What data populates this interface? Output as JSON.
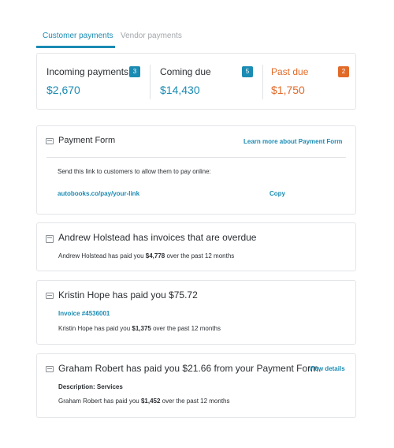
{
  "tabs": {
    "customer": "Customer payments",
    "vendor": "Vendor payments"
  },
  "summary": {
    "incoming": {
      "label": "Incoming payments",
      "count": "3",
      "amount": "$2,670"
    },
    "coming_due": {
      "label": "Coming due",
      "count": "5",
      "amount": "$14,430"
    },
    "past_due": {
      "label": "Past due",
      "count": "2",
      "amount": "$1,750"
    }
  },
  "payment_form": {
    "title": "Payment Form",
    "learn_more": "Learn more about Payment Form",
    "description": "Send this link to customers to allow them to pay online:",
    "link": "autobooks.co/pay/your-link",
    "copy": "Copy"
  },
  "activity": [
    {
      "title": "Andrew Holstead has invoices that are overdue",
      "summary_prefix": "Andrew Holstead has paid you",
      "summary_amount": "$4,778",
      "summary_suffix": "over the past 12 months"
    },
    {
      "title": "Kristin Hope has paid you $75.72",
      "invoice": "Invoice #4536001",
      "summary_prefix": "Kristin Hope has paid you",
      "summary_amount": "$1,375",
      "summary_suffix": "over the past 12 months"
    },
    {
      "title": "Graham Robert has paid you $21.66 from your Payment Form.",
      "view_details": "View details",
      "description_label": "Description:",
      "description_value": "Services",
      "summary_prefix": "Graham Robert has paid you",
      "summary_amount": "$1,452",
      "summary_suffix": "over the past 12 months"
    }
  ],
  "colors": {
    "accent": "#1a8bb3",
    "warning": "#e26a28",
    "border": "#e3e5e8"
  },
  "icons": {
    "card": "credit-card-icon"
  }
}
